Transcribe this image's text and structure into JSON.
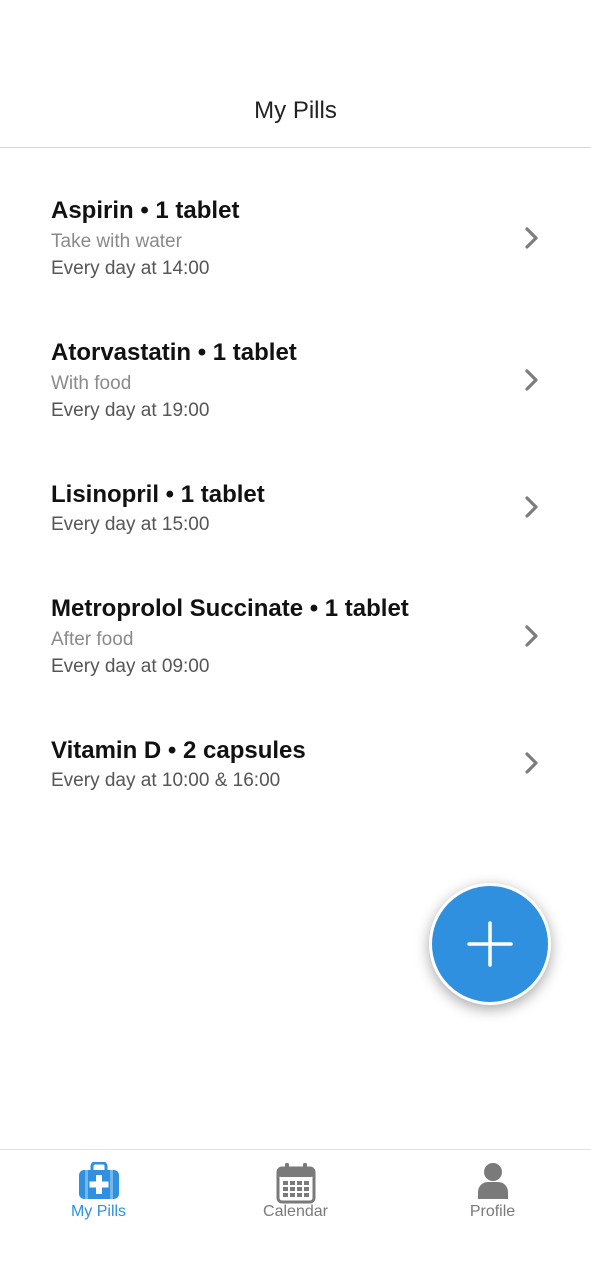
{
  "header": {
    "title": "My Pills"
  },
  "pills": [
    {
      "heading": "Aspirin • 1 tablet",
      "note": "Take with water",
      "schedule": "Every day at 14:00"
    },
    {
      "heading": "Atorvastatin • 1 tablet",
      "note": "With food",
      "schedule": "Every day at 19:00"
    },
    {
      "heading": "Lisinopril • 1 tablet",
      "note": "",
      "schedule": "Every day at 15:00"
    },
    {
      "heading": "Metroprolol Succinate • 1 tablet",
      "note": "After food",
      "schedule": "Every day at 09:00"
    },
    {
      "heading": "Vitamin D • 2 capsules",
      "note": "",
      "schedule": "Every day at 10:00 & 16:00"
    }
  ],
  "fab": {
    "icon": "plus-icon"
  },
  "tabs": [
    {
      "label": "My Pills",
      "icon": "medical-kit-icon",
      "active": true
    },
    {
      "label": "Calendar",
      "icon": "calendar-icon",
      "active": false
    },
    {
      "label": "Profile",
      "icon": "person-icon",
      "active": false
    }
  ],
  "colors": {
    "accent": "#2f90e0",
    "inactive": "#7a7a7a",
    "note": "#8a8a8a",
    "schedule": "#555555"
  }
}
